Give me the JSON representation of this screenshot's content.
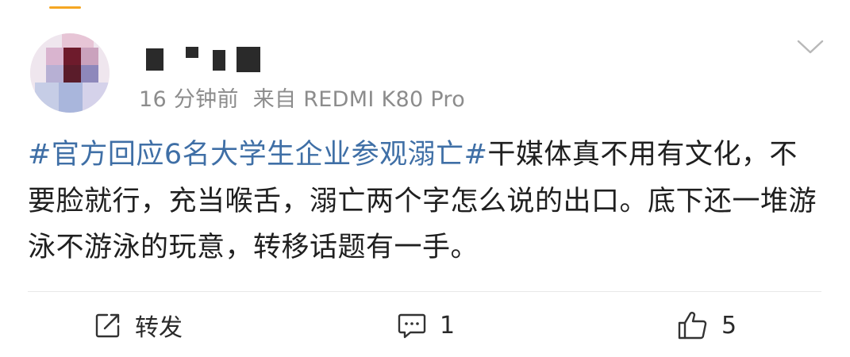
{
  "post": {
    "author_name": "",
    "time": "16 分钟前",
    "source": "来自 REDMI K80 Pro",
    "topic": "#官方回应6名大学生企业参观溺亡#",
    "body": "干媒体真不用有文化，不要脸就行，充当喉舌，溺亡两个字怎么说的出口。底下还一堆游泳不游泳的玩意，转移话题有一手。"
  },
  "actions": {
    "repost_label": "转发",
    "comment_count": "1",
    "like_count": "5"
  },
  "colors": {
    "topic_link": "#3f6fa6",
    "meta_text": "#8c8c8c",
    "body_text": "#1f1f1f",
    "accent": "#f5a623",
    "divider": "#e8e8e8"
  },
  "icons": {
    "menu": "chevron-down-icon",
    "repost": "repost-icon",
    "comment": "comment-icon",
    "like": "thumbs-up-icon"
  }
}
